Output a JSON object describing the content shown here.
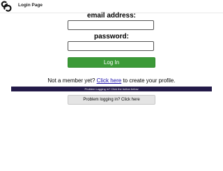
{
  "header": {
    "title": "Login Page",
    "logo_icon": "link-chain-logo-icon"
  },
  "form": {
    "email_label": "email address:",
    "email_value": "",
    "password_label": "password:",
    "password_value": "",
    "login_button": "Log In",
    "login_button_color": "#3c9a38"
  },
  "signup": {
    "prefix": "Not a member yet?",
    "link": "Click here",
    "suffix": "to create your profile."
  },
  "problem": {
    "banner": "Problem Logging in? Click the button below",
    "banner_color": "#231a48",
    "button": "Problem logging in? Click here"
  }
}
